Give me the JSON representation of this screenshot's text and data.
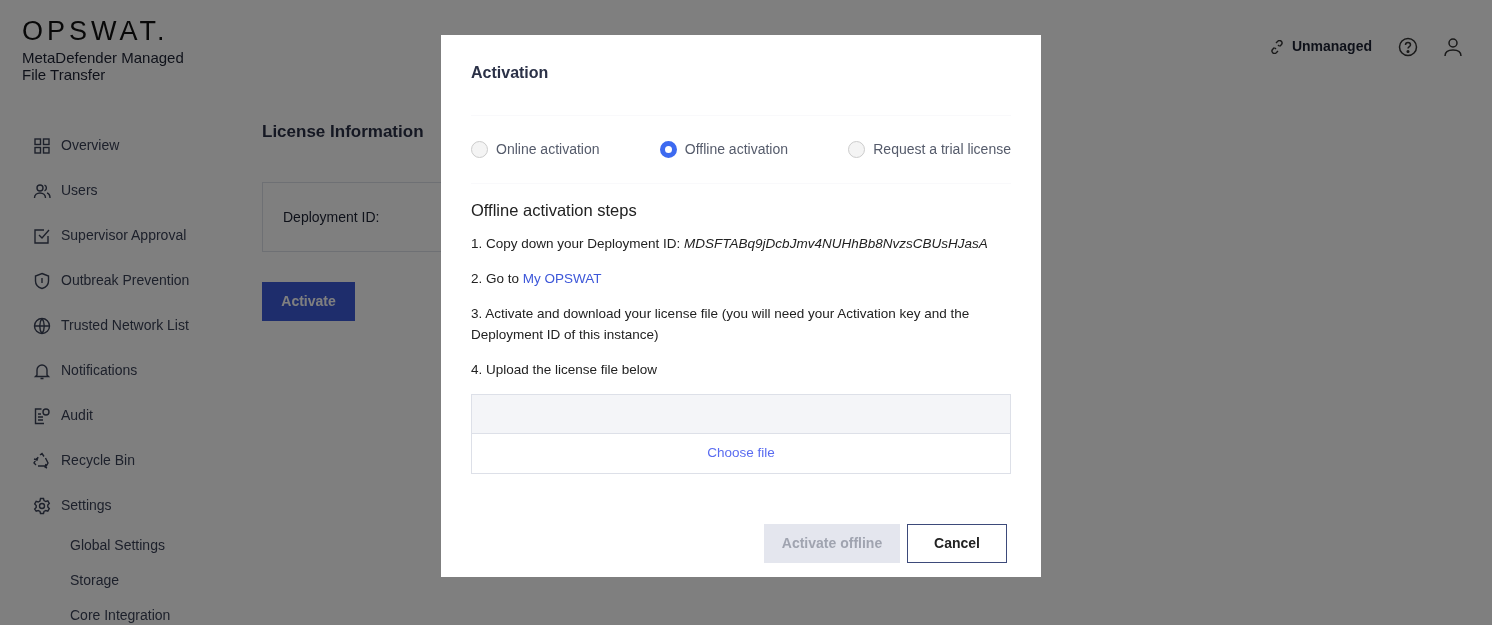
{
  "brand": {
    "logo": "OPSWAT.",
    "product": "MetaDefender Managed File Transfer"
  },
  "header": {
    "status": "Unmanaged"
  },
  "sidebar": {
    "items": [
      {
        "label": "Overview"
      },
      {
        "label": "Users"
      },
      {
        "label": "Supervisor Approval"
      },
      {
        "label": "Outbreak Prevention"
      },
      {
        "label": "Trusted Network List"
      },
      {
        "label": "Notifications"
      },
      {
        "label": "Audit"
      },
      {
        "label": "Recycle Bin"
      },
      {
        "label": "Settings",
        "children": [
          {
            "label": "Global Settings"
          },
          {
            "label": "Storage"
          },
          {
            "label": "Core Integration"
          }
        ]
      }
    ]
  },
  "main": {
    "title": "License Information",
    "field_label": "Deployment ID:",
    "button": "Activate"
  },
  "dialog": {
    "title": "Activation",
    "options": [
      {
        "label": "Online activation",
        "selected": false
      },
      {
        "label": "Offline activation",
        "selected": true
      },
      {
        "label": "Request a trial license",
        "selected": false
      }
    ],
    "heading": "Offline activation steps",
    "steps": [
      {
        "text": "1. Copy down your Deployment ID: *MDSFTABq9jDcbJmv4NUHhBb8NvzsCBUsHJasA*"
      },
      {
        "text": "2. Go to ",
        "link": "My OPSWAT"
      },
      {
        "text": "3. Activate and download your license file (you will need your Activation key and the Deployment ID of this instance)"
      },
      {
        "text": "4. Upload the license file below"
      }
    ],
    "upload": {
      "button": "Choose file"
    },
    "buttons": [
      {
        "label": "Activate offline",
        "disabled": true
      },
      {
        "label": "Cancel",
        "disabled": false
      }
    ]
  }
}
